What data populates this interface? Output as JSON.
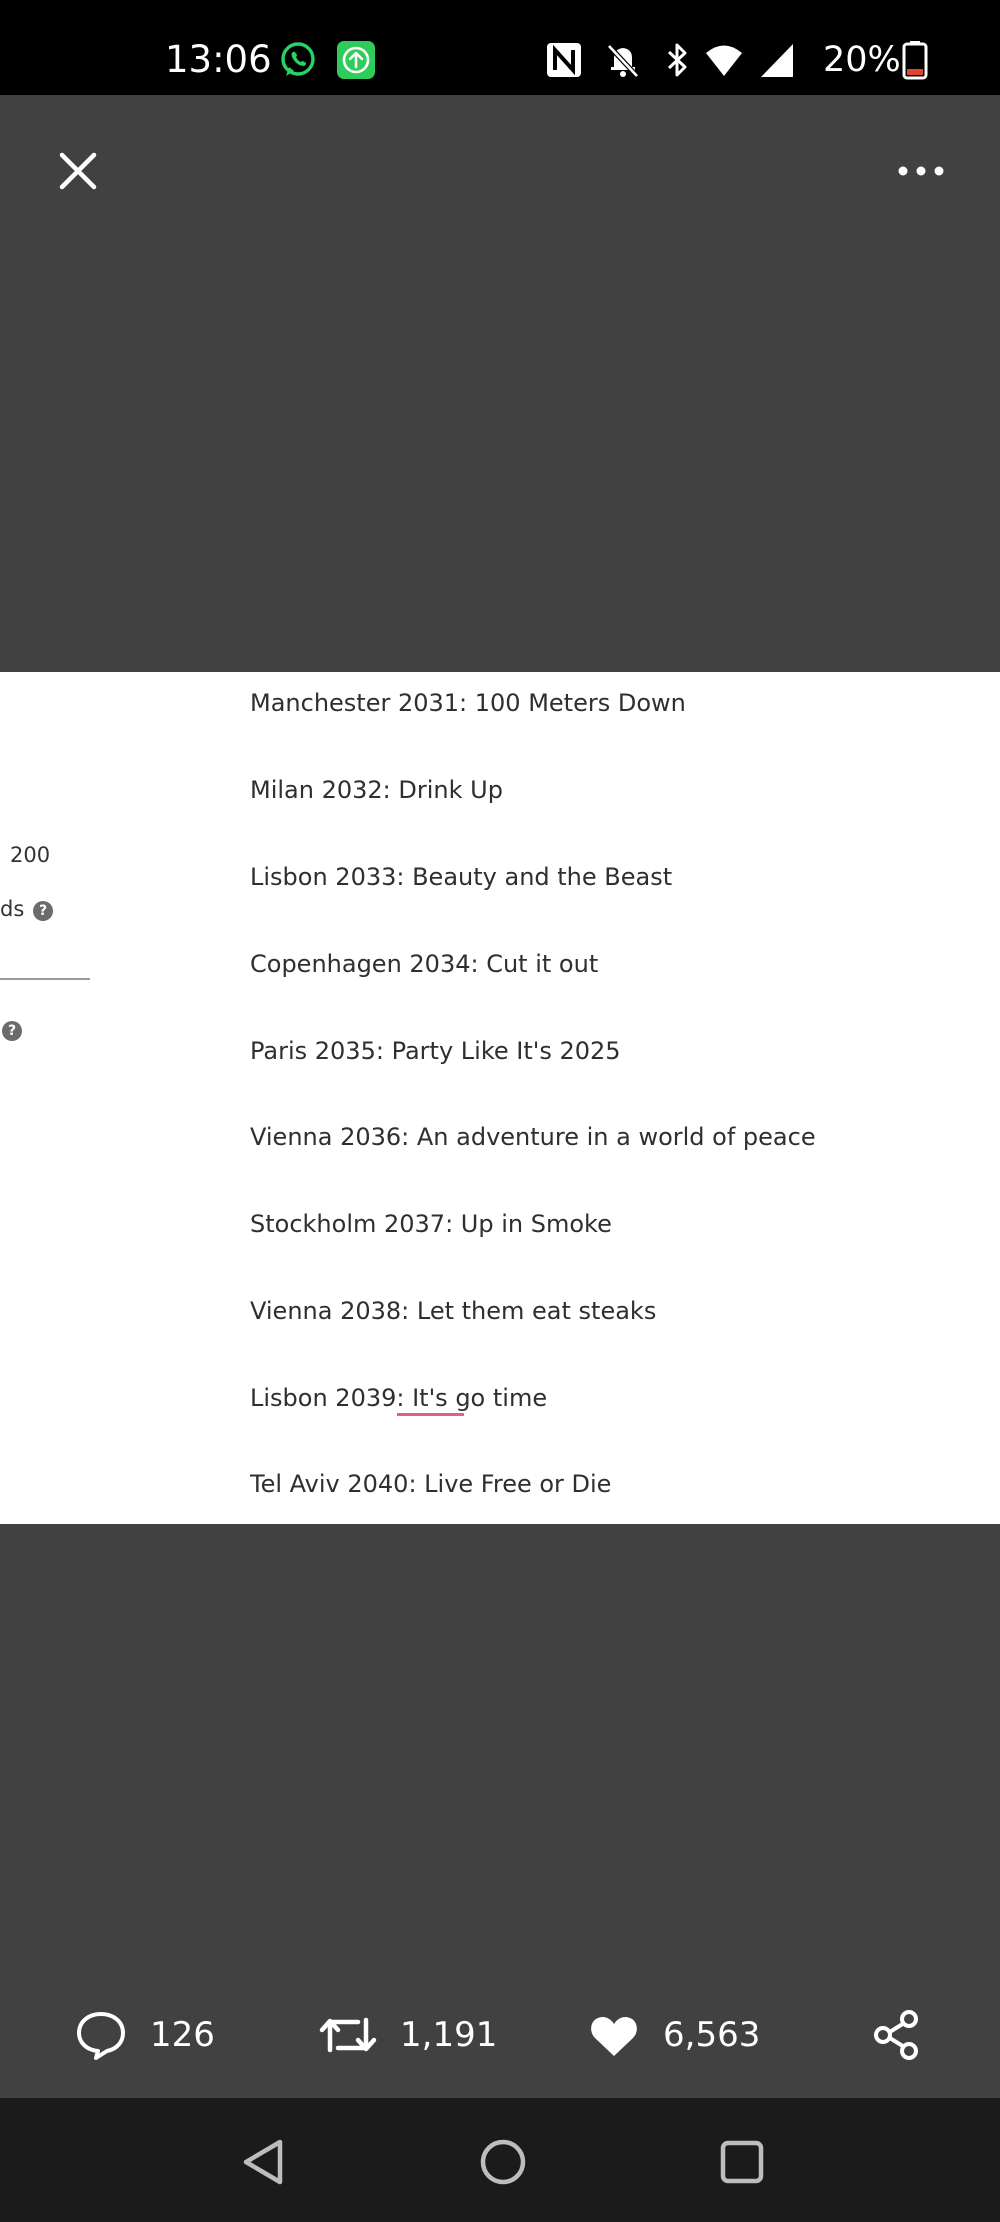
{
  "status_bar": {
    "time": "13:06",
    "battery": "20%",
    "icons": [
      "whatsapp-icon",
      "upload-icon",
      "nfc-icon",
      "bell-off-icon",
      "bluetooth-icon",
      "wifi-icon",
      "signal-icon",
      "battery-icon"
    ],
    "colors": {
      "whatsapp": "#25D366",
      "upload_badge": "#2ecc5a",
      "battery_low": "#e0442f"
    }
  },
  "top_bar": {
    "close_icon": "close-icon",
    "more_icon": "more-icon"
  },
  "image": {
    "list": [
      "Manchester 2031: 100 Meters Down",
      "Milan 2032: Drink Up",
      "Lisbon 2033: Beauty and the Beast",
      "Copenhagen 2034: Cut it out",
      "Paris 2035: Party Like It's 2025",
      "Vienna 2036: An adventure in a world of peace",
      "Stockholm 2037: Up in Smoke",
      "Vienna 2038: Let them eat steaks",
      "Lisbon 2039: It's go time",
      "Tel Aviv 2040: Live Free or Die"
    ],
    "side": {
      "number": "200",
      "word_fragment": "ds",
      "help_mark": "?"
    }
  },
  "actions": {
    "replies": "126",
    "retweets": "1,191",
    "likes": "6,563"
  },
  "nav": {
    "icons": [
      "back-icon",
      "home-icon",
      "recents-icon"
    ]
  }
}
